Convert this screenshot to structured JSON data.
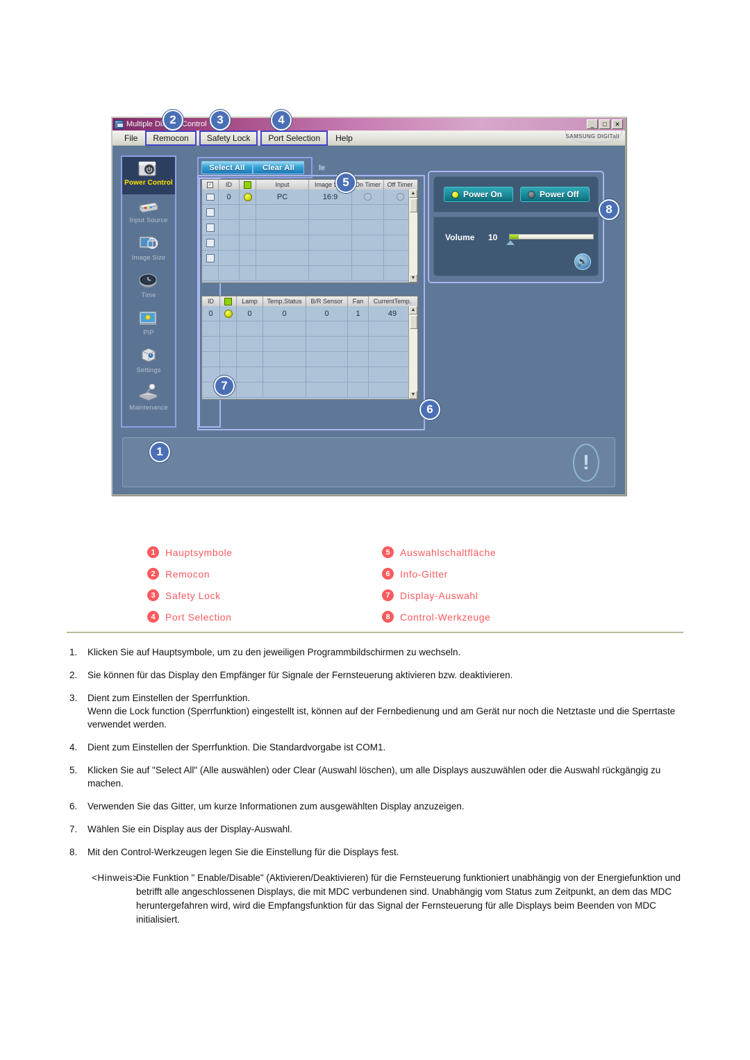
{
  "app": {
    "title": "Multiple Display Control",
    "brand": "SAMSUNG DIGITall",
    "titlebar_buttons": [
      {
        "name": "minimize",
        "glyph": "_"
      },
      {
        "name": "maximize",
        "glyph": "□"
      },
      {
        "name": "close",
        "glyph": "✕"
      }
    ],
    "menu": [
      {
        "label": "File",
        "boxed": false
      },
      {
        "label": "Remocon",
        "boxed": true
      },
      {
        "label": "Safety Lock",
        "boxed": true
      },
      {
        "label": "Port Selection",
        "boxed": true
      },
      {
        "label": "Help",
        "boxed": false
      }
    ],
    "sidebar": [
      {
        "label": "Power Control",
        "icon": "power-control-icon",
        "active": true
      },
      {
        "label": "Input Source",
        "icon": "input-source-icon",
        "active": false
      },
      {
        "label": "Image Size",
        "icon": "image-size-icon",
        "active": false
      },
      {
        "label": "Time",
        "icon": "clock-icon",
        "active": false
      },
      {
        "label": "PIP",
        "icon": "pip-icon",
        "active": false
      },
      {
        "label": "Settings",
        "icon": "settings-cube-icon",
        "active": false
      },
      {
        "label": "Maintenance",
        "icon": "maintenance-icon",
        "active": false
      }
    ],
    "top_buttons": [
      {
        "label": "Select All"
      },
      {
        "label": "Clear All"
      }
    ],
    "partial_label": "le",
    "display_grid": {
      "columns": [
        "",
        "ID",
        "",
        "Input",
        "Image Size",
        "On Timer",
        "Off Timer"
      ],
      "header_icons": [
        "checkbox-icon",
        "",
        "power-icon",
        "",
        "",
        "",
        ""
      ],
      "rows": [
        {
          "checked": false,
          "id": "0",
          "power": "on",
          "input": "PC",
          "image_size": "16:9",
          "on_timer": "circle",
          "off_timer": "circle"
        },
        {
          "checked": false,
          "id": "",
          "power": "",
          "input": "",
          "image_size": "",
          "on_timer": "",
          "off_timer": ""
        },
        {
          "checked": false,
          "id": "",
          "power": "",
          "input": "",
          "image_size": "",
          "on_timer": "",
          "off_timer": ""
        },
        {
          "checked": false,
          "id": "",
          "power": "",
          "input": "",
          "image_size": "",
          "on_timer": "",
          "off_timer": ""
        },
        {
          "checked": false,
          "id": "",
          "power": "",
          "input": "",
          "image_size": "",
          "on_timer": "",
          "off_timer": ""
        },
        {
          "checked": false,
          "id": "",
          "power": "",
          "input": "",
          "image_size": "",
          "on_timer": "",
          "off_timer": ""
        }
      ]
    },
    "info_grid": {
      "columns": [
        "ID",
        "",
        "Lamp",
        "Temp.Status",
        "B/R Sensor",
        "Fan",
        "CurrentTemp."
      ],
      "header_icons": [
        "",
        "power-icon",
        "",
        "",
        "",
        "",
        ""
      ],
      "rows": [
        {
          "id": "0",
          "power": "on",
          "lamp": "0",
          "temp_status": "0",
          "br_sensor": "0",
          "fan": "1",
          "current_temp": "49"
        },
        {
          "id": "",
          "power": "",
          "lamp": "",
          "temp_status": "",
          "br_sensor": "",
          "fan": "",
          "current_temp": ""
        },
        {
          "id": "",
          "power": "",
          "lamp": "",
          "temp_status": "",
          "br_sensor": "",
          "fan": "",
          "current_temp": ""
        },
        {
          "id": "",
          "power": "",
          "lamp": "",
          "temp_status": "",
          "br_sensor": "",
          "fan": "",
          "current_temp": ""
        },
        {
          "id": "",
          "power": "",
          "lamp": "",
          "temp_status": "",
          "br_sensor": "",
          "fan": "",
          "current_temp": ""
        },
        {
          "id": "",
          "power": "",
          "lamp": "",
          "temp_status": "",
          "br_sensor": "",
          "fan": "",
          "current_temp": ""
        }
      ]
    },
    "control_tools": {
      "power_on_label": "Power On",
      "power_off_label": "Power Off",
      "volume_label": "Volume",
      "volume_value": "10",
      "speaker_icon": "speaker-icon"
    },
    "callouts": [
      "1",
      "2",
      "3",
      "4",
      "5",
      "6",
      "7",
      "8"
    ],
    "scroll_up_glyph": "▲",
    "scroll_down_glyph": "▼"
  },
  "legend": {
    "left": [
      {
        "num": "1",
        "label": "Hauptsymbole"
      },
      {
        "num": "2",
        "label": "Remocon"
      },
      {
        "num": "3",
        "label": "Safety Lock"
      },
      {
        "num": "4",
        "label": "Port Selection"
      }
    ],
    "right": [
      {
        "num": "5",
        "label": "Auswahlschaltfläche"
      },
      {
        "num": "6",
        "label": "Info-Gitter"
      },
      {
        "num": "7",
        "label": "Display-Auswahl"
      },
      {
        "num": "8",
        "label": "Control-Werkzeuge"
      }
    ]
  },
  "instructions": [
    {
      "num": "1.",
      "text": "Klicken Sie auf Hauptsymbole, um zu den jeweiligen Programmbildschirmen zu wechseln."
    },
    {
      "num": "2.",
      "text": "Sie können für das Display den Empfänger für Signale der Fernsteuerung aktivieren bzw. deaktivieren."
    },
    {
      "num": "3.",
      "text": "Dient zum Einstellen der Sperrfunktion.\nWenn die Lock function (Sperrfunktion) eingestellt ist, können auf der Fernbedienung und am Gerät nur noch die Netztaste und die Sperrtaste verwendet werden."
    },
    {
      "num": "4.",
      "text": "Dient zum Einstellen der Sperrfunktion. Die Standardvorgabe ist COM1."
    },
    {
      "num": "5.",
      "text": "Klicken Sie auf \"Select All\" (Alle auswählen) oder Clear (Auswahl löschen), um alle Displays auszuwählen oder die Auswahl rückgängig zu machen."
    },
    {
      "num": "6.",
      "text": "Verwenden Sie das Gitter, um kurze Informationen zum ausgewählten Display anzuzeigen."
    },
    {
      "num": "7.",
      "text": "Wählen Sie ein Display aus der Display-Auswahl."
    },
    {
      "num": "8.",
      "text": "Mit den Control-Werkzeugen legen Sie die Einstellung für die Displays fest."
    }
  ],
  "note": {
    "key": "<Hinweis>",
    "text": "Die Funktion \" Enable/Disable\" (Aktivieren/Deaktivieren) für die Fernsteuerung funktioniert unabhängig von der Energiefunktion und betrifft alle angeschlossenen Displays, die mit MDC verbundenen sind. Unabhängig vom Status zum Zeitpunkt, an dem das MDC heruntergefahren wird, wird die Empfangsfunktion für das Signal der Fernsteuerung für alle Displays beim Beenden von MDC initialisiert."
  },
  "colors": {
    "accent_red": "#fb5a5e",
    "callout_blue": "#4a6fb5",
    "titlebar_magenta": "#a0437f",
    "app_bg": "#5f7897",
    "active_sidebar": "#2d3f5f",
    "active_label_yellow": "#ffe400",
    "button_cyan": "#1b8a99",
    "grid_row_blue": "#aec3d8"
  }
}
